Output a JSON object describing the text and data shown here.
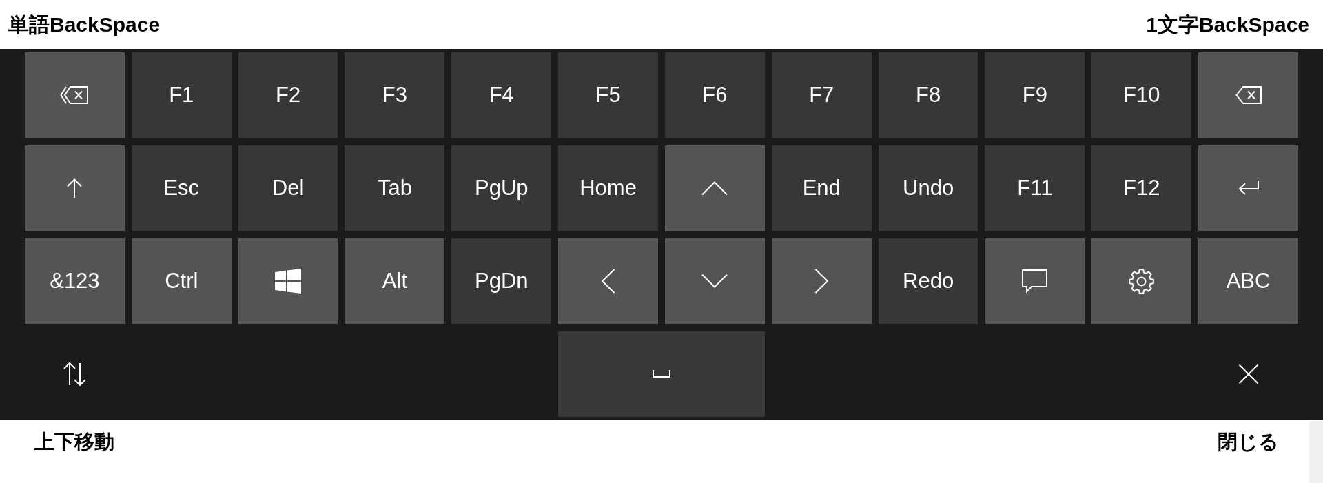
{
  "top_labels": [
    {
      "text": "単語BackSpace"
    },
    {
      "text": "1文字BackSpace"
    }
  ],
  "keyboard": {
    "rows": [
      [
        {
          "kind": "wordback",
          "color": "#545454"
        },
        {
          "kind": "text",
          "label": "F1",
          "color": "#373737"
        },
        {
          "kind": "text",
          "label": "F2",
          "color": "#373737"
        },
        {
          "kind": "text",
          "label": "F3",
          "color": "#373737"
        },
        {
          "kind": "text",
          "label": "F4",
          "color": "#373737"
        },
        {
          "kind": "text",
          "label": "F5",
          "color": "#373737"
        },
        {
          "kind": "text",
          "label": "F6",
          "color": "#373737"
        },
        {
          "kind": "text",
          "label": "F7",
          "color": "#373737"
        },
        {
          "kind": "text",
          "label": "F8",
          "color": "#373737"
        },
        {
          "kind": "text",
          "label": "F9",
          "color": "#373737"
        },
        {
          "kind": "text",
          "label": "F10",
          "color": "#373737"
        },
        {
          "kind": "backspace",
          "color": "#545454"
        }
      ],
      [
        {
          "kind": "uparrow",
          "color": "#545454"
        },
        {
          "kind": "text",
          "label": "Esc",
          "color": "#373737"
        },
        {
          "kind": "text",
          "label": "Del",
          "color": "#373737"
        },
        {
          "kind": "text",
          "label": "Tab",
          "color": "#373737"
        },
        {
          "kind": "text",
          "label": "PgUp",
          "color": "#373737"
        },
        {
          "kind": "text",
          "label": "Home",
          "color": "#373737"
        },
        {
          "kind": "chevronup",
          "color": "#545454"
        },
        {
          "kind": "text",
          "label": "End",
          "color": "#373737"
        },
        {
          "kind": "text",
          "label": "Undo",
          "color": "#373737"
        },
        {
          "kind": "text",
          "label": "F11",
          "color": "#373737"
        },
        {
          "kind": "text",
          "label": "F12",
          "color": "#373737"
        },
        {
          "kind": "enter",
          "color": "#545454"
        }
      ],
      [
        {
          "kind": "text",
          "label": "&123",
          "color": "#545454"
        },
        {
          "kind": "text",
          "label": "Ctrl",
          "color": "#545454"
        },
        {
          "kind": "windows",
          "color": "#545454"
        },
        {
          "kind": "text",
          "label": "Alt",
          "color": "#545454"
        },
        {
          "kind": "text",
          "label": "PgDn",
          "color": "#373737"
        },
        {
          "kind": "chevronleft",
          "color": "#545454"
        },
        {
          "kind": "chevrondown",
          "color": "#545454"
        },
        {
          "kind": "chevronright",
          "color": "#545454"
        },
        {
          "kind": "text",
          "label": "Redo",
          "color": "#373737"
        },
        {
          "kind": "comment",
          "color": "#545454"
        },
        {
          "kind": "gear",
          "color": "#545454"
        },
        {
          "kind": "text",
          "label": "ABC",
          "color": "#545454"
        }
      ],
      [
        {
          "kind": "updown"
        },
        {
          "kind": "space",
          "color": "#393939"
        },
        {
          "kind": "close"
        }
      ]
    ]
  },
  "bottom_labels": [
    {
      "text": "上下移動"
    },
    {
      "text": "閉じる"
    }
  ]
}
